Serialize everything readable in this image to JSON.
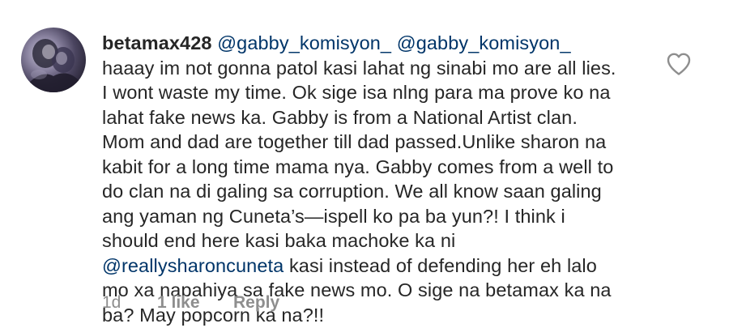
{
  "comment": {
    "username": "betamax428",
    "mention_1": "@gabby_komisyon_",
    "mention_2": "@gabby_komisyon_",
    "text_1": " haaay im not gonna patol kasi lahat ng sinabi mo are all lies. I wont waste my time. Ok sige isa nlng para ma prove ko na lahat fake news ka. Gabby is from a National Artist clan. Mom and dad are together till dad passed.Unlike sharon na kabit for a long time mama nya. Gabby comes from a well to do clan na di galing sa corruption. We all know saan galing ang yaman ng Cuneta’s—ispell ko pa ba yun?! I think i should end here kasi baka machoke ka ni ",
    "mention_3": "@reallysharoncuneta",
    "text_2": " kasi instead of defending her eh lalo mo xa napahiya sa fake news mo. O sige na betamax ka na ba? May popcorn ka na?!!",
    "timestamp": "1d",
    "likes": "1 like",
    "reply_label": "Reply"
  },
  "icons": {
    "avatar": "avatar",
    "like": "heart-outline-icon"
  },
  "colors": {
    "text": "#262626",
    "mention": "#003569",
    "meta": "#8e8e8e",
    "icon": "#8e8e8e"
  }
}
